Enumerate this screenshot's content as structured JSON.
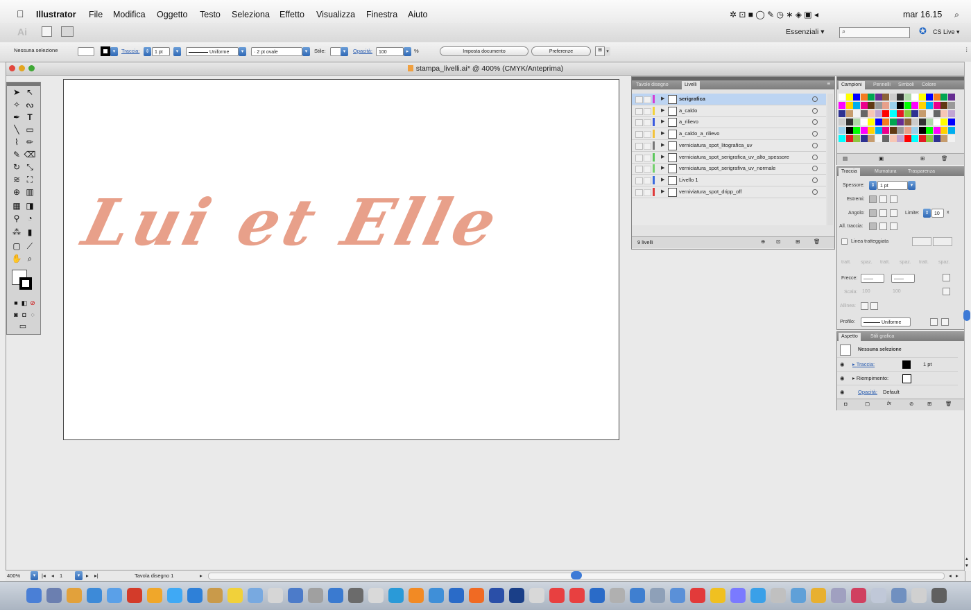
{
  "menubar": {
    "app_name": "Illustrator",
    "items": [
      "File",
      "Modifica",
      "Oggetto",
      "Testo",
      "Seleziona",
      "Effetto",
      "Visualizza",
      "Finestra",
      "Aiuto"
    ],
    "clock": "mar 16.15"
  },
  "appbar": {
    "logo": "Ai",
    "workspace": "Essenziali",
    "cs_live": "CS Live"
  },
  "controlbar": {
    "selection": "Nessuna selezione",
    "stroke_label": "Traccia:",
    "stroke_value": "1 pt",
    "profile": "Uniforme",
    "brush": "2 pt ovale",
    "style_label": "Stile:",
    "opacity_label": "Opacità:",
    "opacity_value": "100",
    "percent": "%",
    "doc_setup": "Imposta documento",
    "preferences": "Preferenze"
  },
  "document": {
    "title": "stampa_livelli.ai* @ 400% (CMYK/Anteprima)",
    "artwork_text": "Lui et Elle",
    "artwork_color": "#e8a08a"
  },
  "layers_panel": {
    "tabs": [
      "Tavole disegno",
      "Livelli"
    ],
    "layers": [
      {
        "name": "serigrafica",
        "color": "#d43dd4",
        "selected": true
      },
      {
        "name": "a_caldo",
        "color": "#f2d23a",
        "selected": false
      },
      {
        "name": "a_rilievo",
        "color": "#3a5ae0",
        "selected": false
      },
      {
        "name": "a_caldo_a_rilievo",
        "color": "#f2c23a",
        "selected": false
      },
      {
        "name": "verniciatura_spot_litografica_uv",
        "color": "#777777",
        "selected": false
      },
      {
        "name": "verniciatura_spot_serigrafica_uv_alto_spessore",
        "color": "#5bc75b",
        "selected": false
      },
      {
        "name": "verniciatura_spot_serigrafiva_uv_normale",
        "color": "#74d06c",
        "selected": false
      },
      {
        "name": "Livello 1",
        "color": "#3a6be0",
        "selected": false
      },
      {
        "name": "verniviatura_spot_dripp_off",
        "color": "#e03a3a",
        "selected": false
      }
    ],
    "count": "9 livelli"
  },
  "swatches_panel": {
    "tabs": [
      "Campioni",
      "Pennelli",
      "Simboli",
      "Colore"
    ]
  },
  "stroke_panel": {
    "tabs": [
      "Traccia",
      "Mumatura",
      "Trasparenza"
    ],
    "weight_label": "Spessore:",
    "weight_value": "1 pt",
    "caps_label": "Estremi:",
    "corner_label": "Angolo:",
    "limit_label": "Limite:",
    "limit_value": "10",
    "limit_unit": "x",
    "align_label": "All. traccia:",
    "dashed_label": "Linea tratteggiata",
    "dash_labels": [
      "tratt.",
      "spaz.",
      "tratt.",
      "spaz.",
      "tratt.",
      "spaz."
    ],
    "arrows_label": "Frecce:",
    "scale_label": "Scala:",
    "scale_a": "100",
    "scale_b": "100",
    "align2_label": "Allinea:",
    "profile_label": "Profilo:",
    "profile_value": "Uniforme"
  },
  "appearance_panel": {
    "tabs": [
      "Aspetto",
      "Stili grafica"
    ],
    "header": "Nessuna selezione",
    "stroke_label": "Traccia:",
    "stroke_value": "1 pt",
    "fill_label": "Riempimento:",
    "opacity_label": "Opacità:",
    "opacity_value": "Default"
  },
  "statusbar": {
    "zoom": "400%",
    "page": "1",
    "artboard_label": "Tavola disegno 1"
  }
}
